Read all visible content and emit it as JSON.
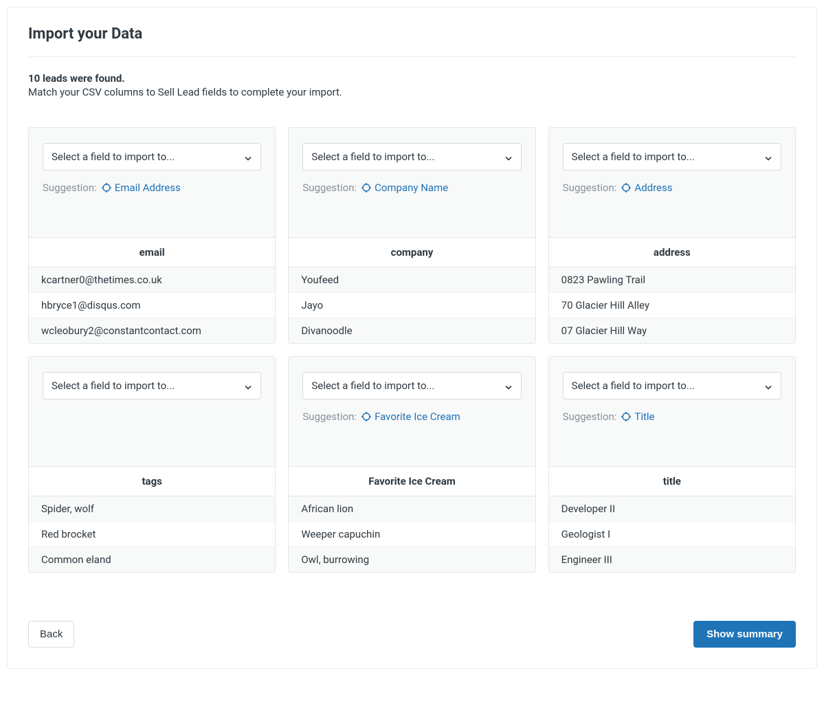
{
  "page": {
    "title": "Import your Data",
    "status": "10 leads were found.",
    "help": "Match your CSV columns to Sell Lead fields to complete your import."
  },
  "select_placeholder": "Select a field to import to...",
  "suggestion_label": "Suggestion:",
  "columns": [
    {
      "suggestion": "Email Address",
      "has_suggestion": true,
      "source_name": "email",
      "rows": [
        "kcartner0@thetimes.co.uk",
        "hbryce1@disqus.com",
        "wcleobury2@constantcontact.com"
      ]
    },
    {
      "suggestion": "Company Name",
      "has_suggestion": true,
      "source_name": "company",
      "rows": [
        "Youfeed",
        "Jayo",
        "Divanoodle"
      ]
    },
    {
      "suggestion": "Address",
      "has_suggestion": true,
      "source_name": "address",
      "rows": [
        "0823 Pawling Trail",
        "70 Glacier Hill Alley",
        "07 Glacier Hill Way"
      ]
    },
    {
      "suggestion": "",
      "has_suggestion": false,
      "source_name": "tags",
      "rows": [
        "Spider, wolf",
        "Red brocket",
        "Common eland"
      ]
    },
    {
      "suggestion": "Favorite Ice Cream",
      "has_suggestion": true,
      "source_name": "Favorite Ice Cream",
      "rows": [
        "African lion",
        "Weeper capuchin",
        "Owl, burrowing"
      ]
    },
    {
      "suggestion": "Title",
      "has_suggestion": true,
      "source_name": "title",
      "rows": [
        "Developer II",
        "Geologist I",
        "Engineer III"
      ]
    }
  ],
  "footer": {
    "back": "Back",
    "summary": "Show summary"
  }
}
